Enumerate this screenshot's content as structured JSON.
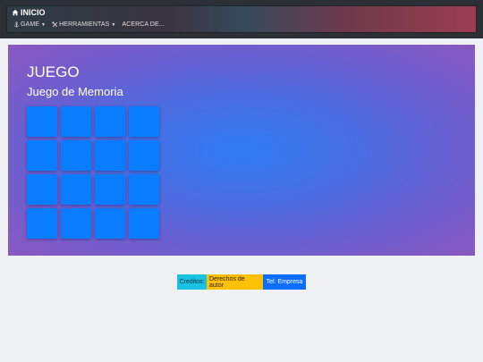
{
  "navbar": {
    "brand_label": "INICIO",
    "menu": [
      {
        "label": "GAME",
        "icon": "anchor-icon",
        "has_dropdown": true
      },
      {
        "label": "HERRAMIENTAS",
        "icon": "tools-icon",
        "has_dropdown": true
      },
      {
        "label": "ACERCA DE...",
        "icon": "",
        "has_dropdown": false
      }
    ]
  },
  "hero": {
    "title": "JUEGO",
    "subtitle": "Juego de Memoria",
    "grid": {
      "rows": 4,
      "cols": 4,
      "card_color": "#0a7cff"
    }
  },
  "footer": {
    "credits": "Creditos:",
    "rights": "Derechos de autor",
    "tel": "Tel: Empresa"
  },
  "colors": {
    "hero_center": "#2f7bf2",
    "hero_edge": "#8a58c0",
    "credits_bg": "#17c2e3",
    "rights_bg": "#ffc107",
    "tel_bg": "#0d6efd"
  }
}
